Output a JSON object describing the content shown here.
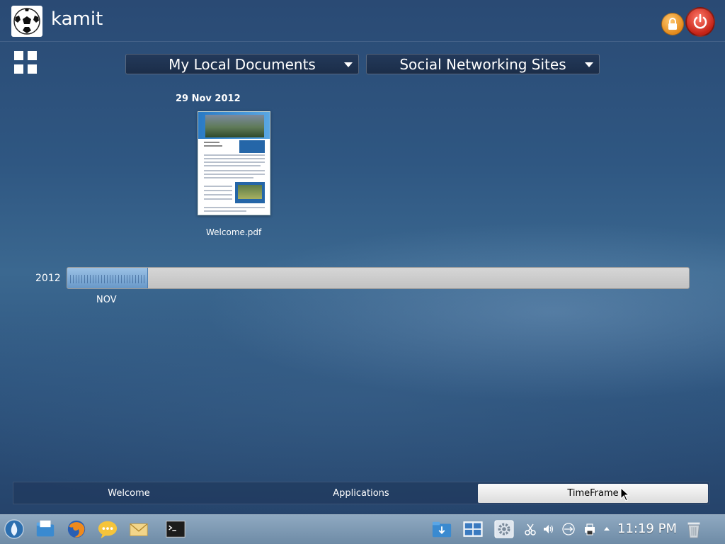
{
  "header": {
    "username": "kamit"
  },
  "filters": {
    "source": "My Local Documents",
    "site": "Social Networking Sites"
  },
  "documents": [
    {
      "date": "29 Nov 2012",
      "name": "Welcome.pdf"
    }
  ],
  "timeline": {
    "year": "2012",
    "month": "NOV",
    "selected_fraction": 0.13
  },
  "tabs": [
    {
      "label": "Welcome",
      "active": false
    },
    {
      "label": "Applications",
      "active": false
    },
    {
      "label": "TimeFrame",
      "active": true
    }
  ],
  "taskbar": {
    "clock": "11:19 PM",
    "launchers": [
      "kde-menu-icon",
      "file-manager-icon",
      "firefox-icon",
      "chat-icon",
      "mail-icon",
      "terminal-icon"
    ],
    "tray": [
      "downloads-icon",
      "desktop-grid-icon",
      "settings-icon",
      "clipboard-icon",
      "volume-icon",
      "network-icon",
      "printer-icon",
      "trash-icon"
    ]
  },
  "colors": {
    "accent": "#2f5782",
    "lock": "#e38a1c",
    "power": "#c42216"
  }
}
